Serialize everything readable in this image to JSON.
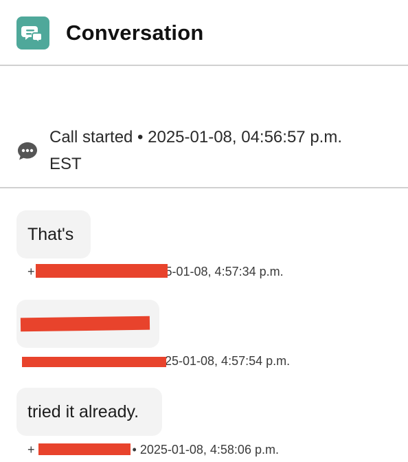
{
  "header": {
    "title": "Conversation",
    "icon": "chat-bubbles-icon",
    "icon_color": "#4fa89a"
  },
  "call": {
    "icon": "chat-dots-icon",
    "line1": "Call started • 2025-01-08, 04:56:57 p.m.",
    "line2": "EST"
  },
  "messages": [
    {
      "text": "That's",
      "meta_prefix": "+",
      "meta_suffix": "5-01-08, 4:57:34 p.m."
    },
    {
      "text": "",
      "meta_prefix": "",
      "meta_suffix": "25-01-08, 4:57:54 p.m."
    },
    {
      "text": "tried it already.",
      "meta_prefix": "+",
      "meta_suffix": "• 2025-01-08, 4:58:06 p.m."
    }
  ],
  "colors": {
    "redaction": "#e8432c",
    "bubble": "#f3f3f3",
    "divider": "#d0d0d0"
  }
}
